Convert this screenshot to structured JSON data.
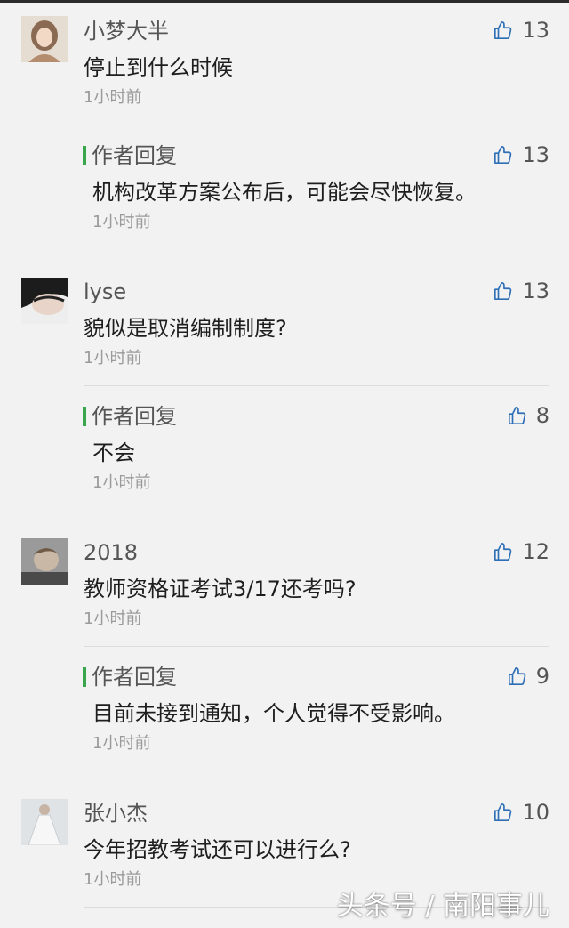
{
  "comments": [
    {
      "username": "小梦大半",
      "text": "停止到什么时候",
      "time": "1小时前",
      "likes": "13",
      "reply": {
        "label": "作者回复",
        "text": "机构改革方案公布后，可能会尽快恢复。",
        "time": "1小时前",
        "likes": "13"
      }
    },
    {
      "username": "lyse",
      "text": "貌似是取消编制制度?",
      "time": "1小时前",
      "likes": "13",
      "reply": {
        "label": "作者回复",
        "text": "不会",
        "time": "1小时前",
        "likes": "8"
      }
    },
    {
      "username": "2018",
      "text": "教师资格证考试3/17还考吗?",
      "time": "1小时前",
      "likes": "12",
      "reply": {
        "label": "作者回复",
        "text": "目前未接到通知，个人觉得不受影响。",
        "time": "1小时前",
        "likes": "9"
      }
    },
    {
      "username": "张小杰",
      "text": "今年招教考试还可以进行么?",
      "time": "1小时前",
      "likes": "10"
    }
  ],
  "watermark": "头条号 / 南阳事儿",
  "colors": {
    "background": "#f2f2f2",
    "reply_bar": "#3aa64c",
    "text": "#1e1e1e",
    "muted": "#9a9a9a"
  },
  "icons": {
    "like": "thumbs-up-icon"
  }
}
